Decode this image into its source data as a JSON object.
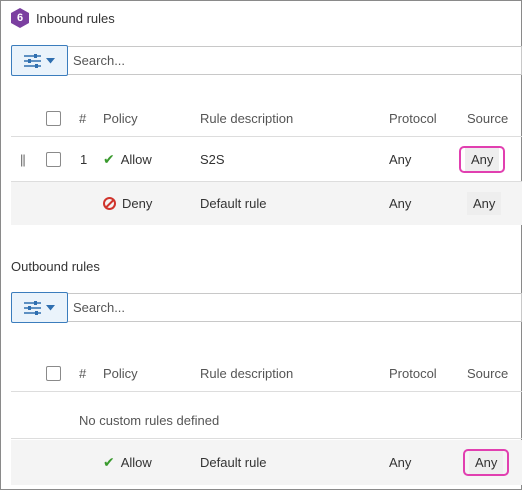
{
  "inbound": {
    "badge": "6",
    "title": "Inbound rules",
    "search_placeholder": "Search...",
    "headers": {
      "num": "#",
      "policy": "Policy",
      "description": "Rule description",
      "protocol": "Protocol",
      "source": "Source"
    },
    "rows": [
      {
        "num": "1",
        "policy": "Allow",
        "description": "S2S",
        "protocol": "Any",
        "source": "Any"
      },
      {
        "num": "",
        "policy": "Deny",
        "description": "Default rule",
        "protocol": "Any",
        "source": "Any"
      }
    ]
  },
  "outbound": {
    "title": "Outbound rules",
    "search_placeholder": "Search...",
    "headers": {
      "num": "#",
      "policy": "Policy",
      "description": "Rule description",
      "protocol": "Protocol",
      "source": "Source"
    },
    "empty_text": "No custom rules defined",
    "rows": [
      {
        "policy": "Allow",
        "description": "Default rule",
        "protocol": "Any",
        "source": "Any"
      }
    ]
  },
  "icons": {
    "filter": "sliders-icon",
    "dropdown": "caret-down-icon",
    "drag": "drag-handle-icon",
    "allow": "check-icon",
    "deny": "blocked-icon"
  },
  "colors": {
    "badge": "#7b3fa0",
    "accent": "#3b7dbd",
    "allow": "#3a9a2e",
    "deny": "#d0342c",
    "highlight": "#e13fb0"
  }
}
